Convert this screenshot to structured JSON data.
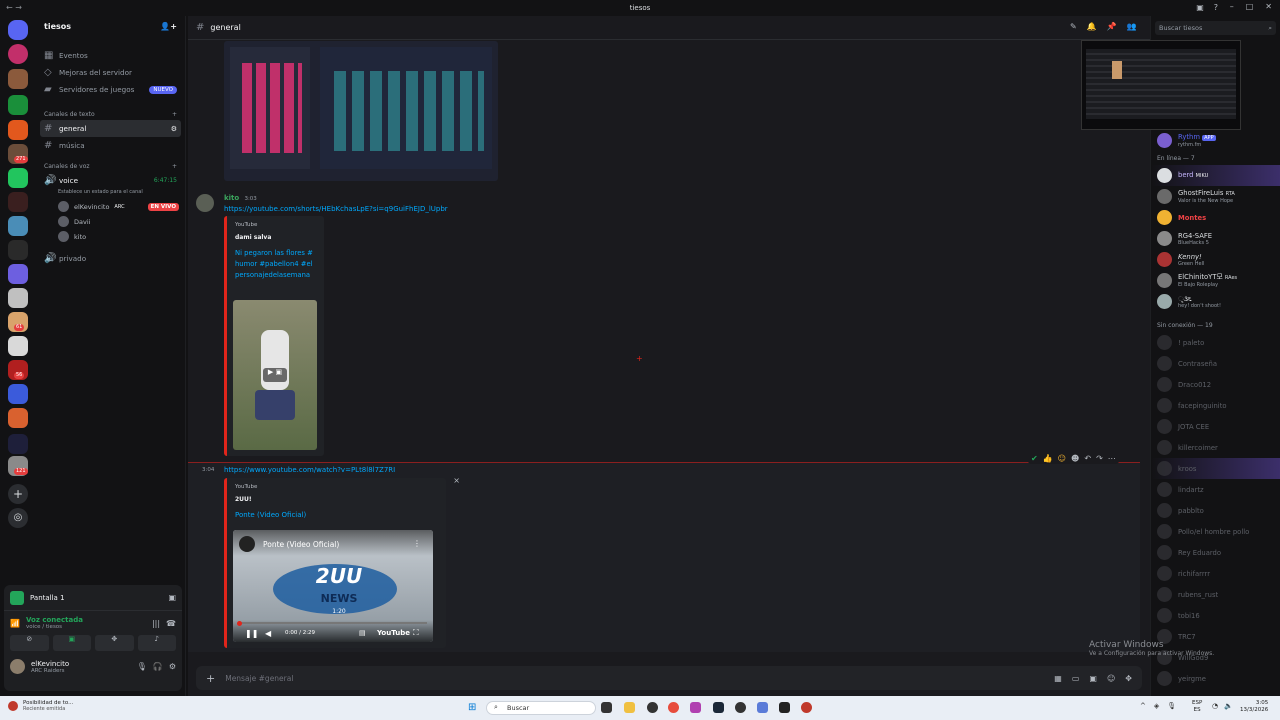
{
  "window": {
    "title": "tiesos",
    "left_label": "← →"
  },
  "colors": {
    "accent": "#5865f2",
    "live": "#ed4245",
    "youtube": "#e1251b",
    "link": "#00a8fc"
  },
  "servers": {
    "badges": [
      "271",
      "61",
      "56",
      "121"
    ]
  },
  "guild": {
    "name": "tiesos",
    "menu": [
      {
        "label": "Eventos",
        "icon": "calendar-icon"
      },
      {
        "label": "Mejoras del servidor",
        "icon": "boost-icon"
      },
      {
        "label": "Servidores de juegos",
        "icon": "gamepad-icon",
        "badge": "NUEVO"
      }
    ],
    "text_category": "Canales de texto",
    "text_channels": [
      {
        "name": "general",
        "active": true
      },
      {
        "name": "música",
        "active": false
      }
    ],
    "voice_category": "Canales de voz",
    "voice_channel": {
      "name": "voice",
      "timer": "6:47:15",
      "status": "Establece un estado para el canal",
      "users": [
        {
          "name": "elKevincito",
          "tag": "ARC",
          "live": "EN VIVO"
        },
        {
          "name": "Davii"
        },
        {
          "name": "kito"
        }
      ]
    },
    "private_channel": "privado"
  },
  "panel": {
    "stream": "Pantalla 1",
    "voice_status": "Voz conectada",
    "voice_location": "voice / tiesos",
    "user": {
      "name": "elKevincito",
      "status": "ARC Raiders"
    }
  },
  "channel": {
    "name": "general",
    "search_placeholder": "Buscar tiesos",
    "composer_placeholder": "Mensaje #general"
  },
  "messages": [
    {
      "author": "kito",
      "time": "3:03",
      "link": "https://youtube.com/shorts/HEbKchasLpE?si=q9GuiFhEJD_lUpbr",
      "embed": {
        "provider": "YouTube",
        "author": "dami salva",
        "title": "Ni pegaron las flores #humor #pabellon4 #elpersonajedelasemana"
      }
    },
    {
      "time": "3:04",
      "link": "https://www.youtube.com/watch?v=PLt8l8l7Z7RI",
      "embed": {
        "provider": "YouTube",
        "author": "2UU!",
        "title": "Ponte (Video Oficial)",
        "player": {
          "title": "Ponte (Video Oficial)",
          "logo_text_1": "2UU",
          "logo_text_2": "NEWS",
          "stamp": "1:20",
          "time": "0:00 / 2:29",
          "brand": "YouTube"
        }
      }
    }
  ],
  "members": {
    "app": {
      "name": "Rythm",
      "tag": "APP",
      "sub": "rythm.fm"
    },
    "online_header": "En línea — 7",
    "online": [
      {
        "name": "berd",
        "tag": "MIKU"
      },
      {
        "name": "GhostFireLuis",
        "tag": "RTA",
        "sub": "Valor is the New Hope"
      },
      {
        "name": "Montes"
      },
      {
        "name": "RG4-SAFE",
        "sub": "BlueHacks 5"
      },
      {
        "name": "Kenny!",
        "sub": "Green Hell"
      },
      {
        "name": "ElChinitoYT모",
        "tag": "RAes",
        "sub": "El Bajo Roleplay"
      },
      {
        "name": "ૃ૩૬",
        "sub": "hey! don't shoot!"
      }
    ],
    "offline_header": "Sin conexión — 19",
    "offline": [
      "! paleto",
      "Contraseña",
      "Draco012",
      "facepinguinito",
      "JOTA CEE",
      "killercoimer",
      "kroos",
      "lindartz",
      "pabblto",
      "Pollo/el hombre pollo",
      "Rey Eduardo",
      "richifarrrr",
      "rubens_rust",
      "tobi16",
      "TRC7",
      "WillGod9",
      "yeirgme"
    ]
  },
  "watermark": {
    "title": "Activar Windows",
    "sub": "Ve a Configuración para activar Windows."
  },
  "taskbar": {
    "notif_title": "Posibilidad de to...",
    "notif_sub": "Reciente emitida",
    "search": "Buscar",
    "lang": "ESP",
    "lang_sub": "ES",
    "time": "3:05",
    "date": "13/3/2026"
  }
}
